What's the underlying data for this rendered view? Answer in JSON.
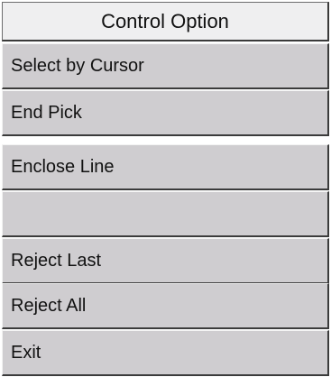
{
  "menu": {
    "title": "Control Option",
    "items": [
      {
        "label": "Select by Cursor"
      },
      {
        "label": "End Pick"
      },
      {
        "label": "Enclose Line"
      },
      {
        "label": ""
      },
      {
        "label": "Reject Last"
      },
      {
        "label": "Reject All"
      },
      {
        "label": "Exit"
      }
    ]
  },
  "colors": {
    "header_bg": "#efeff0",
    "item_bg": "#cfcdd0",
    "bevel_dark": "#3b3b3b",
    "bevel_light": "#f3f3f3"
  }
}
